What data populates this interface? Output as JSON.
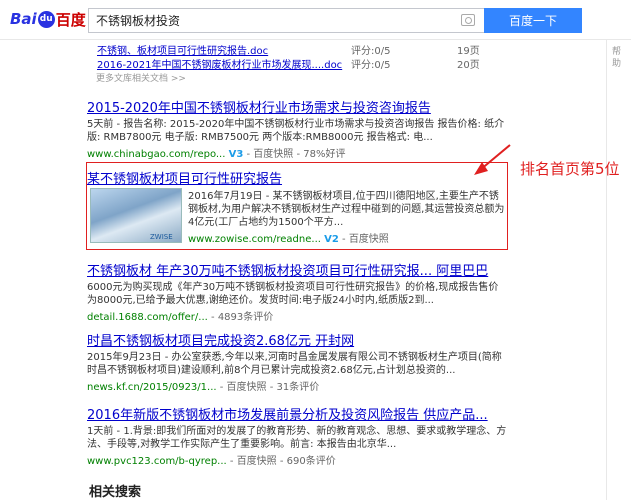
{
  "header": {
    "logo_bai": "Bai",
    "logo_paw": "du",
    "logo_du": "百度",
    "query": "不锈钢板材投资",
    "search_button": "百度一下"
  },
  "right_rail": {
    "line1": "帮",
    "line2": "助"
  },
  "doc_rows": [
    {
      "title": "不锈钢、板材项目可行性研究报告.doc",
      "score": "评分:0/5",
      "pages": "19页"
    },
    {
      "title": "2016-2021年中国不锈钢废板材行业市场发展现....doc",
      "score": "评分:0/5",
      "pages": "20页"
    }
  ],
  "more_link": "更多文库相关文档 >>",
  "results": [
    {
      "title": "2015-2020年中国不锈钢板材行业市场需求与投资咨询报告",
      "abstract": "5天前 - 报告名称: 2015-2020年中国不锈钢板材行业市场需求与投资咨询报告 报告价格: 纸介版: RMB7800元 电子版: RMB7500元 两个版本:RMB8000元 报告格式: 电...",
      "url": "www.chinabgao.com/repo...",
      "v": "V3",
      "kuaizhao": "百度快照",
      "eval": "78%好评"
    },
    {
      "title": "某不锈钢板材项目可行性研究报告",
      "abstract": "2016年7月19日 - 某不锈钢板材项目,位于四川德阳地区,主要生产不锈钢板材,为用户解决不锈钢板材生产过程中碰到的问题,其运营投资总额为4亿元(工厂占地约为1500个平方...",
      "url": "www.zowise.com/readne...",
      "v": "V2",
      "kuaizhao": "百度快照",
      "thumb_label": "ZWISE"
    },
    {
      "title": "不锈钢板材 年产30万吨不锈钢板材投资项目可行性研究报... 阿里巴巴",
      "abstract": "6000元为购买现成《年产30万吨不锈钢板材投资项目可行性研究报告》的价格,现成报告售价为8000元,已给予最大优惠,谢绝还价。发货时间:电子版24小时内,纸质版2到...",
      "url": "detail.1688.com/offer/...",
      "eval": "4893条评价"
    },
    {
      "title": "时昌不锈钢板材项目完成投资2.68亿元 开封网",
      "abstract": "2015年9月23日 - 办公室获悉,今年以来,河南时昌金属发展有限公司不锈钢板材生产项目(简称时昌不锈钢板材项目)建设顺利,前8个月已累计完成投资2.68亿元,占计划总投资的...",
      "url": "news.kf.cn/2015/0923/1...",
      "kuaizhao": "百度快照",
      "eval": "31条评价"
    },
    {
      "title": "2016年新版不锈钢板材市场发展前景分析及投资风险报告 供应产品...",
      "abstract": "1天前 - 1.背景:即我们所面对的发展了的教育形势、新的教育观念、思想、要求或教学理念、方法、手段等,对教学工作实际产生了重要影响。前言: 本报告由北京华...",
      "url": "www.pvc123.com/b-qyrep...",
      "kuaizhao": "百度快照",
      "eval": "690条评价"
    }
  ],
  "annotation": "排名首页第5位",
  "related": "相关搜索",
  "colors": {
    "accent": "#3385ff",
    "link": "#0000cc",
    "highlight": "#cc0000",
    "url": "#008000",
    "annotation": "#e02020"
  }
}
